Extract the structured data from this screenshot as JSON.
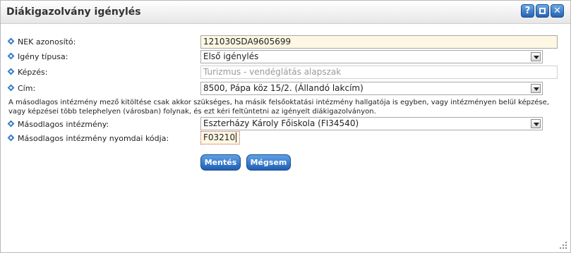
{
  "window": {
    "title": "Diákigazolvány igénylés",
    "help_glyph": "?",
    "close_glyph": "✕"
  },
  "form": {
    "nek": {
      "label": "NEK azonosító:",
      "value": "121030SDA9605699"
    },
    "igeny": {
      "label": "Igény típusa:",
      "value": "Első igénylés"
    },
    "kepzes": {
      "label": "Képzés:",
      "value": "Turizmus - vendéglátás alapszak"
    },
    "cim": {
      "label": "Cím:",
      "value": "8500, Pápa köz 15/2. (Állandó lakcím)"
    },
    "info": "A másodlagos intézmény mező kitöltése csak akkor szükséges, ha másik felsőoktatási intézmény hallgatója is egyben, vagy intézményen belül képzése, vagy képzései több telephelyen (városban) folynak, és ezt kéri feltüntetni az igényelt diákigazolványon.",
    "masodlagos": {
      "label": "Másodlagos intézmény:",
      "value": "Eszterházy Károly Főiskola (FI34540)"
    },
    "nyomdai": {
      "label": "Másodlagos intézmény nyomdai kódja:",
      "value": "F03210"
    }
  },
  "buttons": {
    "save": "Mentés",
    "cancel": "Mégsem"
  },
  "colors": {
    "accent": "#2462b2",
    "highlight_field": "#fdf7e3"
  }
}
